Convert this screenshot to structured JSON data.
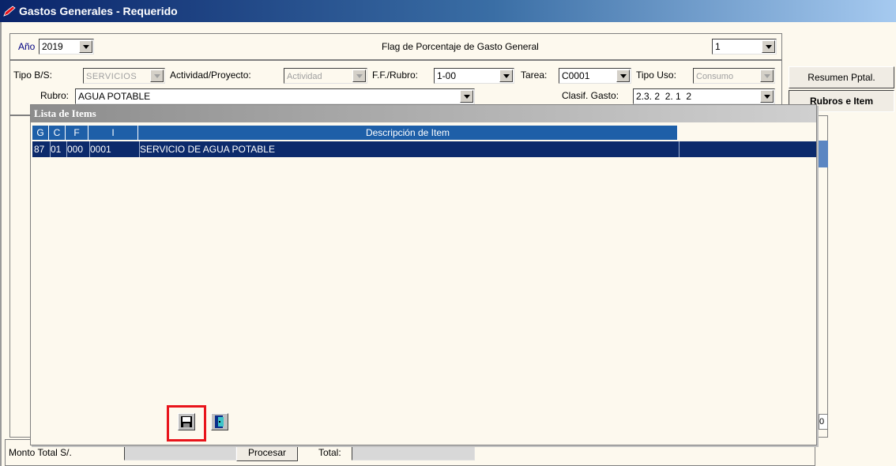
{
  "window": {
    "title": "Gastos Generales - Requerido"
  },
  "top": {
    "anio_label": "Año",
    "anio_value": "2019",
    "flag_label": "Flag de Porcentaje de Gasto General",
    "flag_value": "1"
  },
  "filters": {
    "tipo_bs_label": "Tipo B/S:",
    "tipo_bs_value": "SERVICIOS",
    "actividad_label": "Actividad/Proyecto:",
    "actividad_value": "Actividad",
    "ff_rubro_label": "F.F./Rubro:",
    "ff_rubro_value": "1-00",
    "tarea_label": "Tarea:",
    "tarea_value": "C0001",
    "tipo_uso_label": "Tipo Uso:",
    "tipo_uso_value": "Consumo",
    "rubro_label": "Rubro:",
    "rubro_value": "AGUA POTABLE",
    "clasif_label": "Clasif. Gasto:",
    "clasif_value": "2.3. 2  2. 1  2"
  },
  "side_buttons": {
    "resumen": "Resumen Pptal.",
    "rubros": "Rubros e Item"
  },
  "popup": {
    "title": "Lista de Items",
    "columns": [
      "G",
      "C",
      "F",
      "I",
      "Descripción de Item"
    ],
    "rows": [
      {
        "g": "87",
        "c": "01",
        "f": "000",
        "i": "0001",
        "desc": "SERVICIO DE AGUA POTABLE"
      }
    ]
  },
  "footer": {
    "monto_label": "Monto Total S/.",
    "procesar_label": "Procesar",
    "total_label": "Total:",
    "right_value": "0"
  },
  "icons": {
    "save": "floppy-disk-icon",
    "exit": "exit-door-icon",
    "title": "pencil-icon"
  },
  "colors": {
    "highlight": "#e8141b",
    "selected_row": "#0c2a6b",
    "header": "#1e5fa8"
  }
}
